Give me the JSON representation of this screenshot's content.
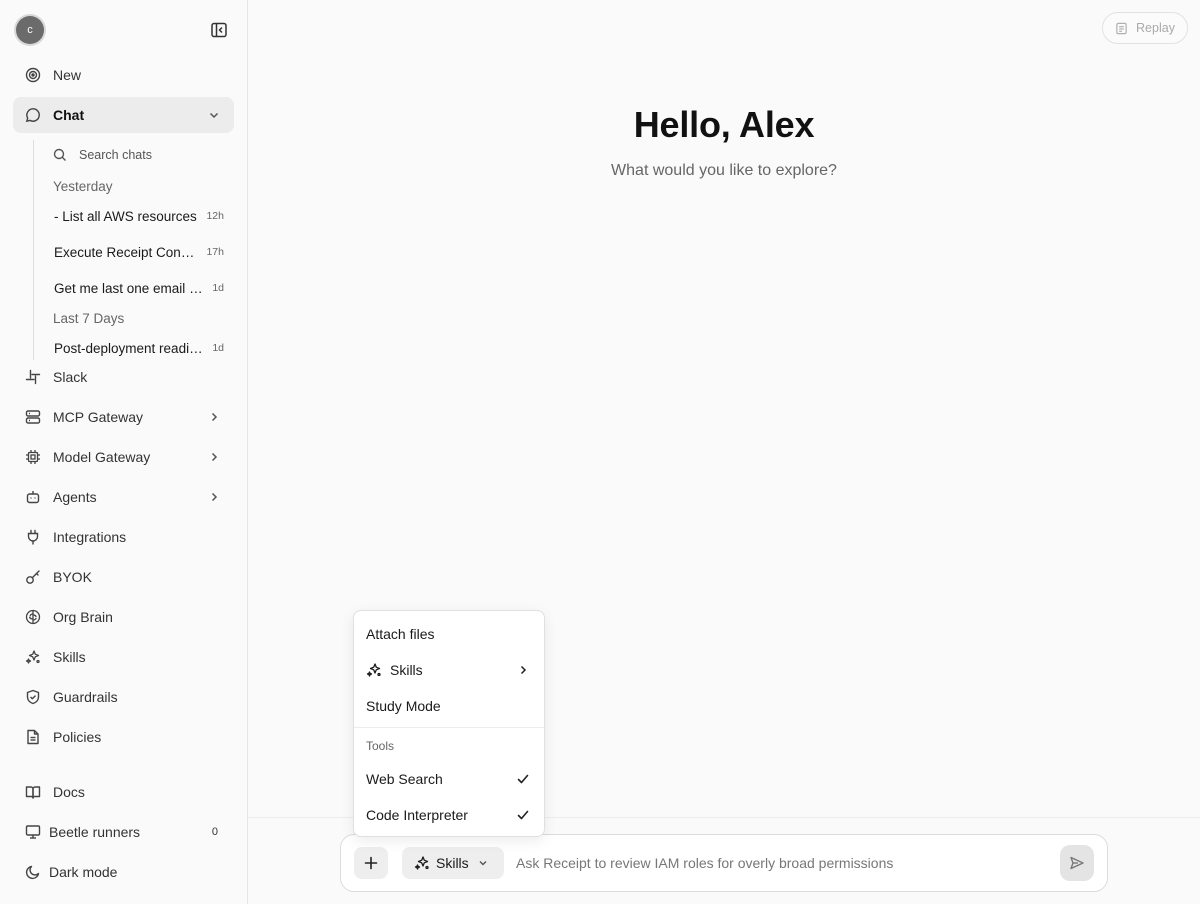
{
  "user": {
    "avatar_initial": "c"
  },
  "sidebar": {
    "new_label": "New",
    "chat_label": "Chat",
    "search_placeholder": "Search chats",
    "groups": {
      "yesterday": "Yesterday",
      "last7": "Last 7 Days"
    },
    "chats": [
      {
        "title": "- List all AWS resources",
        "age": "12h"
      },
      {
        "title": "Execute Receipt Console",
        "age": "17h"
      },
      {
        "title": "Get me last one email from",
        "age": "1d"
      },
      {
        "title": "Post-deployment readiness",
        "age": "1d"
      }
    ],
    "items": [
      {
        "label": "Slack"
      },
      {
        "label": "MCP Gateway"
      },
      {
        "label": "Model Gateway"
      },
      {
        "label": "Agents"
      },
      {
        "label": "Integrations"
      },
      {
        "label": "BYOK"
      },
      {
        "label": "Org Brain"
      },
      {
        "label": "Skills"
      },
      {
        "label": "Guardrails"
      },
      {
        "label": "Policies"
      }
    ],
    "footer": {
      "docs": "Docs",
      "runners": "Beetle runners",
      "runners_count": "0",
      "dark_mode": "Dark mode"
    }
  },
  "header": {
    "replay_label": "Replay"
  },
  "main": {
    "greeting": "Hello, Alex",
    "subtitle": "What would you like to explore?"
  },
  "composer": {
    "skills_label": "Skills",
    "placeholder": "Ask Receipt to review IAM roles for overly broad permissions"
  },
  "menu": {
    "attach": "Attach files",
    "skills": "Skills",
    "study": "Study Mode",
    "tools_heading": "Tools",
    "web_search": "Web Search",
    "code_interpreter": "Code Interpreter"
  }
}
